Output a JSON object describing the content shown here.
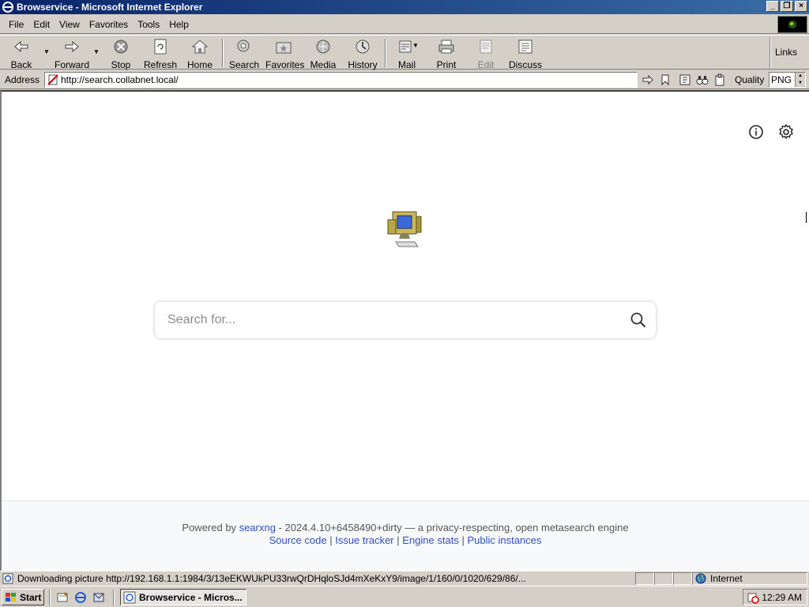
{
  "window": {
    "title": "Browservice - Microsoft Internet Explorer",
    "controls": [
      "minimize",
      "restore",
      "close"
    ]
  },
  "menubar": {
    "items": [
      "File",
      "Edit",
      "View",
      "Favorites",
      "Tools",
      "Help"
    ]
  },
  "toolbar": {
    "back": "Back",
    "forward": "Forward",
    "stop": "Stop",
    "refresh": "Refresh",
    "home": "Home",
    "search": "Search",
    "favorites": "Favorites",
    "media": "Media",
    "history": "History",
    "mail": "Mail",
    "print": "Print",
    "edit": "Edit",
    "discuss": "Discuss",
    "links": "Links"
  },
  "addressbar": {
    "label": "Address",
    "url": "http://search.collabnet.local/",
    "quality_label": "Quality",
    "quality_value": "PNG"
  },
  "page": {
    "search_placeholder": "Search for...",
    "footer": {
      "powered_by": "Powered by",
      "engine_link": "searxng",
      "version_text": "- 2024.4.10+6458490+dirty — a privacy-respecting, open metasearch engine",
      "links": [
        "Source code",
        "Issue tracker",
        "Engine stats",
        "Public instances"
      ],
      "separator": "|"
    }
  },
  "statusbar": {
    "text": "Downloading picture http://192.168.1.1:1984/3/13eEKWUkPU33rwQrDHqloSJd4mXeKxY9/image/1/160/0/1020/629/86/...",
    "zone": "Internet"
  },
  "taskbar": {
    "start": "Start",
    "task_label": "Browservice - Micros...",
    "clock": "12:29 AM"
  },
  "colors": {
    "titlebar_start": "#0a246a",
    "titlebar_end": "#3a6ea5",
    "link": "#3050c0",
    "chrome": "#d4d0c8"
  }
}
